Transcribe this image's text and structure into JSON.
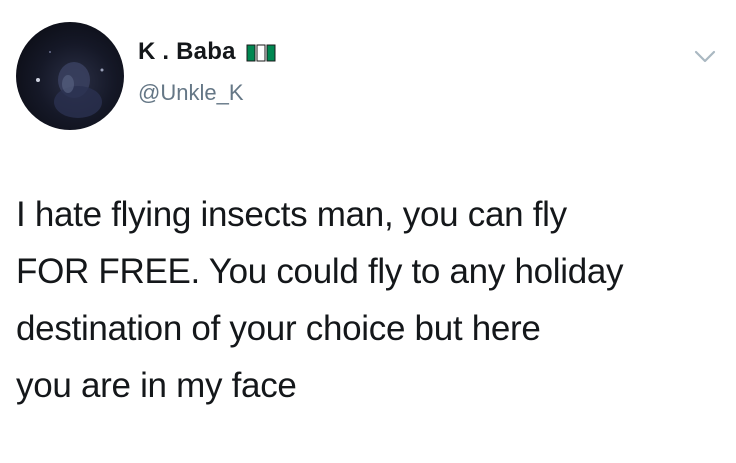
{
  "tweet": {
    "author": {
      "display_name": "K . Baba",
      "handle": "@Unkle_K",
      "flag_icon": "nigeria-flag-icon",
      "flag_colors": [
        "#008751",
        "#ffffff",
        "#008751"
      ]
    },
    "menu_icon": "chevron-down-icon",
    "text_lines": [
      "I hate flying insects man, you can fly",
      "FOR FREE. You could fly to any holiday",
      "destination of your choice but here",
      "you are in my face"
    ]
  },
  "colors": {
    "text": "#14171a",
    "secondary_text": "#657786",
    "chevron": "#aab8c2",
    "background": "#ffffff"
  }
}
